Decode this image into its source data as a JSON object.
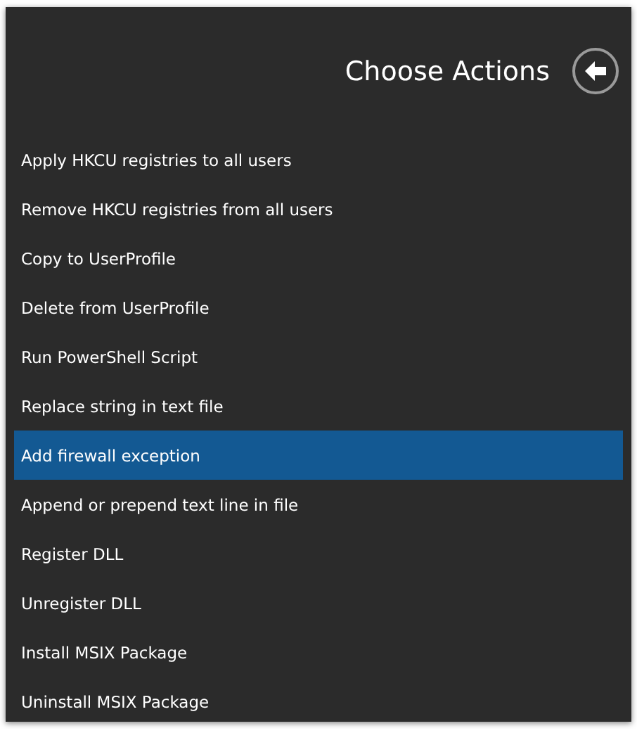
{
  "header": {
    "title": "Choose Actions"
  },
  "actions": [
    {
      "label": "Apply HKCU registries to all users",
      "selected": false
    },
    {
      "label": "Remove HKCU registries from all users",
      "selected": false
    },
    {
      "label": "Copy to UserProfile",
      "selected": false
    },
    {
      "label": "Delete from UserProfile",
      "selected": false
    },
    {
      "label": "Run PowerShell Script",
      "selected": false
    },
    {
      "label": "Replace string in text file",
      "selected": false
    },
    {
      "label": "Add firewall exception",
      "selected": true
    },
    {
      "label": "Append or prepend text line in file",
      "selected": false
    },
    {
      "label": "Register DLL",
      "selected": false
    },
    {
      "label": "Unregister DLL",
      "selected": false
    },
    {
      "label": "Install MSIX Package",
      "selected": false
    },
    {
      "label": "Uninstall MSIX Package",
      "selected": false
    }
  ]
}
